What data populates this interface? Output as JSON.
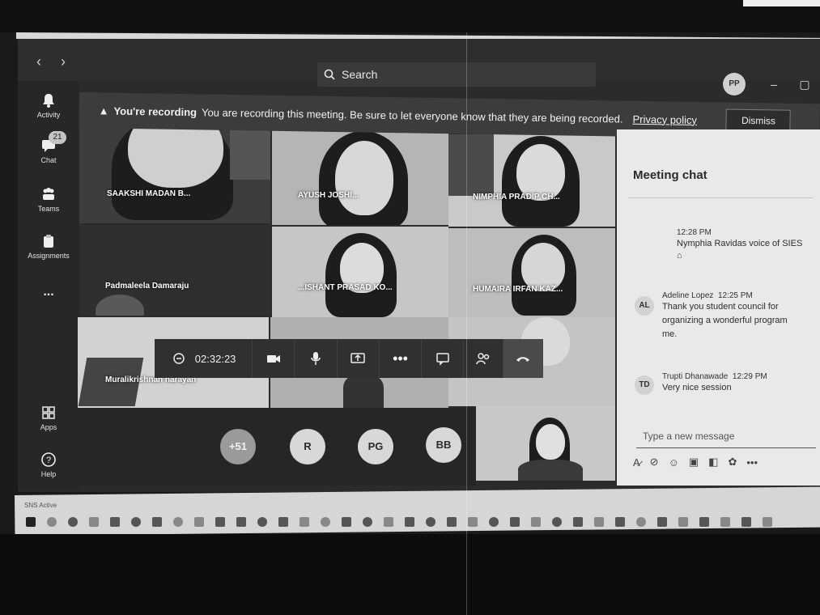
{
  "search": {
    "label": "Search"
  },
  "user_avatar": {
    "initials": "PP"
  },
  "rail": {
    "items": [
      {
        "label": "Activity",
        "icon": "bell-icon"
      },
      {
        "label": "Chat",
        "icon": "chat-icon",
        "badge": "21"
      },
      {
        "label": "Teams",
        "icon": "teams-icon"
      },
      {
        "label": "Assignments",
        "icon": "assignments-icon"
      },
      {
        "label": "...",
        "icon": "more-icon"
      },
      {
        "label": "Apps",
        "icon": "apps-icon"
      },
      {
        "label": "Help",
        "icon": "help-icon"
      }
    ]
  },
  "banner": {
    "title": "You're recording",
    "message": "You are recording this meeting. Be sure to let everyone know that they are being recorded.",
    "link": "Privacy policy",
    "dismiss": "Dismiss"
  },
  "tiles": [
    {
      "name": "SAAKSHI MADAN B..."
    },
    {
      "name": "AYUSH JOSHI..."
    },
    {
      "name": "NIMPHIA PRADIP CH..."
    },
    {
      "name": "Padmaleela Damaraju"
    },
    {
      "name": "...ISHANT PRASAD KO..."
    },
    {
      "name": "HUMAIRA IRFAN KAZ..."
    },
    {
      "name": "Muralikrishnan narayan"
    }
  ],
  "controls": {
    "timer": "02:32:23"
  },
  "participants": [
    {
      "initials": "+51"
    },
    {
      "initials": "R"
    },
    {
      "initials": "PG"
    },
    {
      "initials": "BB"
    }
  ],
  "chat": {
    "title": "Meeting chat",
    "messages": [
      {
        "time": "12:28 PM",
        "sender": "",
        "initials": "",
        "text": "Nymphia Ravidas voice of SIES"
      },
      {
        "time": "12:25 PM",
        "sender": "Adeline Lopez",
        "initials": "AL",
        "text": "Thank you student council for organizing a wonderful program me."
      },
      {
        "time": "12:29 PM",
        "sender": "Trupti Dhanawade",
        "initials": "TD",
        "text": "Very nice session"
      }
    ],
    "compose_placeholder": "Type a new message"
  },
  "taskbar": {
    "label": "SNS Active"
  }
}
